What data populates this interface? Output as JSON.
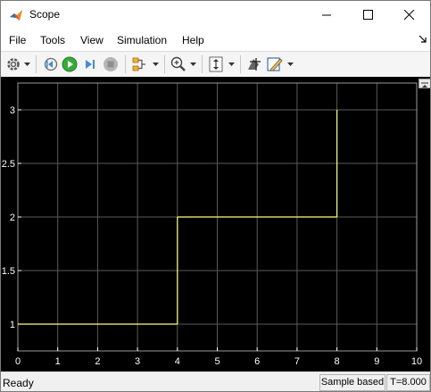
{
  "window": {
    "title": "Scope"
  },
  "menu": {
    "items": [
      "File",
      "Tools",
      "View",
      "Simulation",
      "Help"
    ]
  },
  "toolbar": {
    "icons": [
      "gear-icon",
      "step-back-icon",
      "run-icon",
      "step-forward-icon",
      "stop-icon",
      "signal-selector-icon",
      "zoom-icon",
      "scale-axes-icon",
      "cursor-measurements-icon",
      "style-icon"
    ]
  },
  "chart_data": {
    "type": "line",
    "x_ticks": [
      "0",
      "1",
      "2",
      "3",
      "4",
      "5",
      "6",
      "7",
      "8",
      "9",
      "10"
    ],
    "y_ticks": [
      "1",
      "1.5",
      "2",
      "2.5",
      "3"
    ],
    "xlim": [
      0,
      10
    ],
    "ylim": [
      0.75,
      3.25
    ],
    "grid": true,
    "series": [
      {
        "style": "step",
        "color": "#ffff80",
        "x": [
          0,
          4,
          4,
          8,
          8
        ],
        "y": [
          1,
          1,
          2,
          2,
          3
        ]
      }
    ],
    "background": "#000000",
    "axis_color": "#ffffff",
    "grid_color": "#5a5a5a"
  },
  "status": {
    "ready": "Ready",
    "mode": "Sample based",
    "time": "T=8.000"
  }
}
